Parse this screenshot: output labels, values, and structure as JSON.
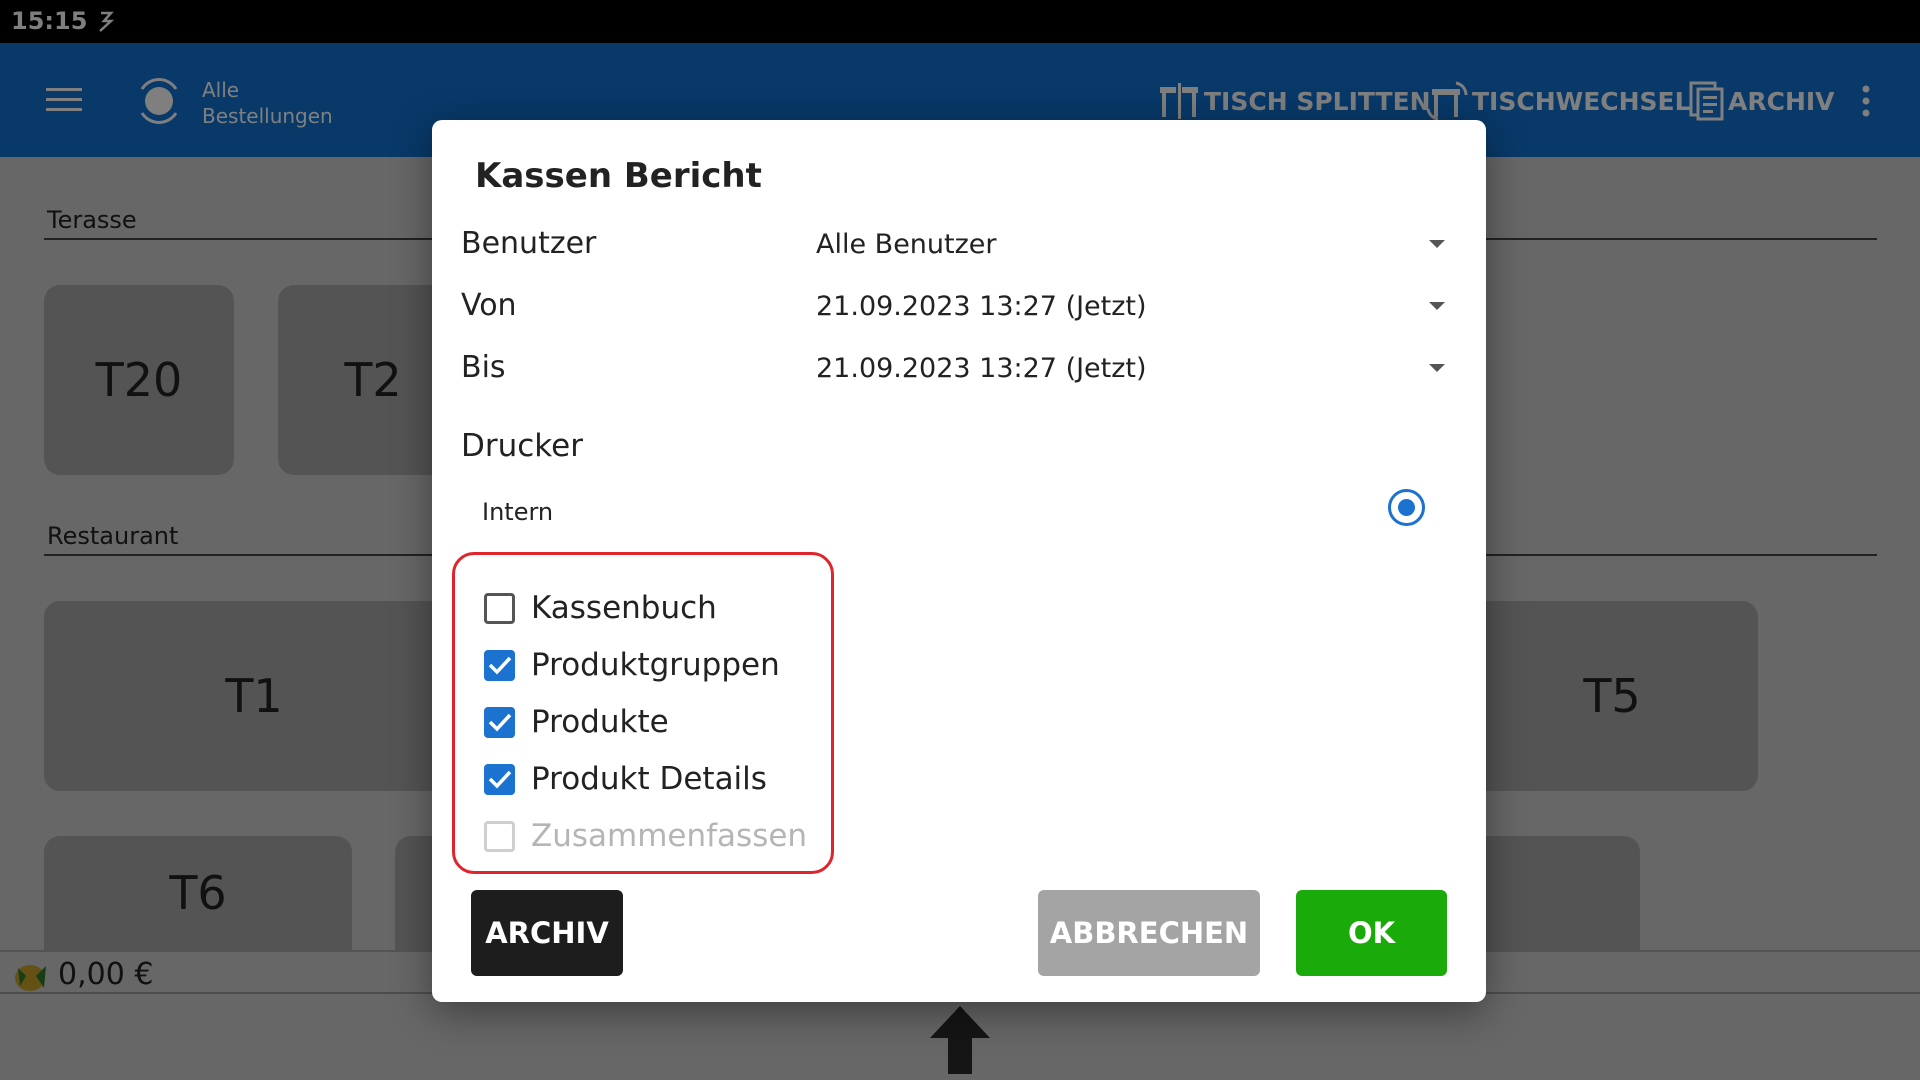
{
  "status_bar": {
    "time": "15:15"
  },
  "app_bar": {
    "title": "Alle Bestellungen",
    "actions": [
      {
        "label": "TISCH SPLITTEN",
        "icon": "split-table-icon"
      },
      {
        "label": "TISCHWECHSEL",
        "icon": "change-table-icon"
      },
      {
        "label": "ARCHIV",
        "icon": "archive-icon"
      }
    ]
  },
  "sections": [
    {
      "label": "Terasse",
      "tables": [
        "T20",
        "T2"
      ]
    },
    {
      "label": "Restaurant",
      "tables": [
        "T1",
        "T5",
        "T6"
      ]
    }
  ],
  "bottom_bar": {
    "total": "0,00 €"
  },
  "dialog": {
    "title": "Kassen Bericht",
    "fields": [
      {
        "label": "Benutzer",
        "value": "Alle Benutzer"
      },
      {
        "label": "Von",
        "value": "21.09.2023 13:27 (Jetzt)"
      },
      {
        "label": "Bis",
        "value": "21.09.2023 13:27 (Jetzt)"
      }
    ],
    "printer_label": "Drucker",
    "printer_option": "Intern",
    "options": [
      {
        "label": "Kassenbuch",
        "checked": false,
        "enabled": true
      },
      {
        "label": "Produktgruppen",
        "checked": true,
        "enabled": true
      },
      {
        "label": "Produkte",
        "checked": true,
        "enabled": true
      },
      {
        "label": "Produkt Details",
        "checked": true,
        "enabled": true
      },
      {
        "label": "Zusammenfassen",
        "checked": false,
        "enabled": false
      }
    ],
    "buttons": {
      "archiv": "ARCHIV",
      "cancel": "ABBRECHEN",
      "ok": "OK"
    },
    "colors": {
      "accent": "#1b72cf",
      "ok": "#1aab0a",
      "highlight": "#e0242d"
    }
  }
}
